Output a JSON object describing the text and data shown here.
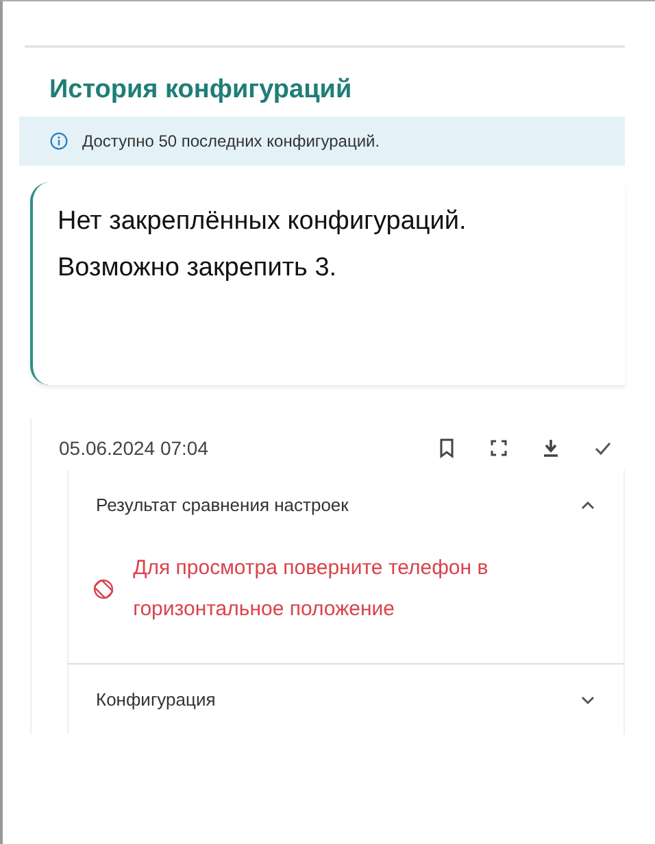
{
  "title": "История конфигураций",
  "info": {
    "text": "Доступно 50 последних конфигураций."
  },
  "pinned_message": "Нет закреплённых конфигураций. Возможно закрепить 3.",
  "entry": {
    "date": "05.06.2024 07:04",
    "sections": [
      {
        "title": "Результат сравнения настроек",
        "expanded": true,
        "warning": "Для просмотра поверните телефон в горизонтальное положение"
      },
      {
        "title": "Конфигурация",
        "expanded": false
      }
    ]
  }
}
